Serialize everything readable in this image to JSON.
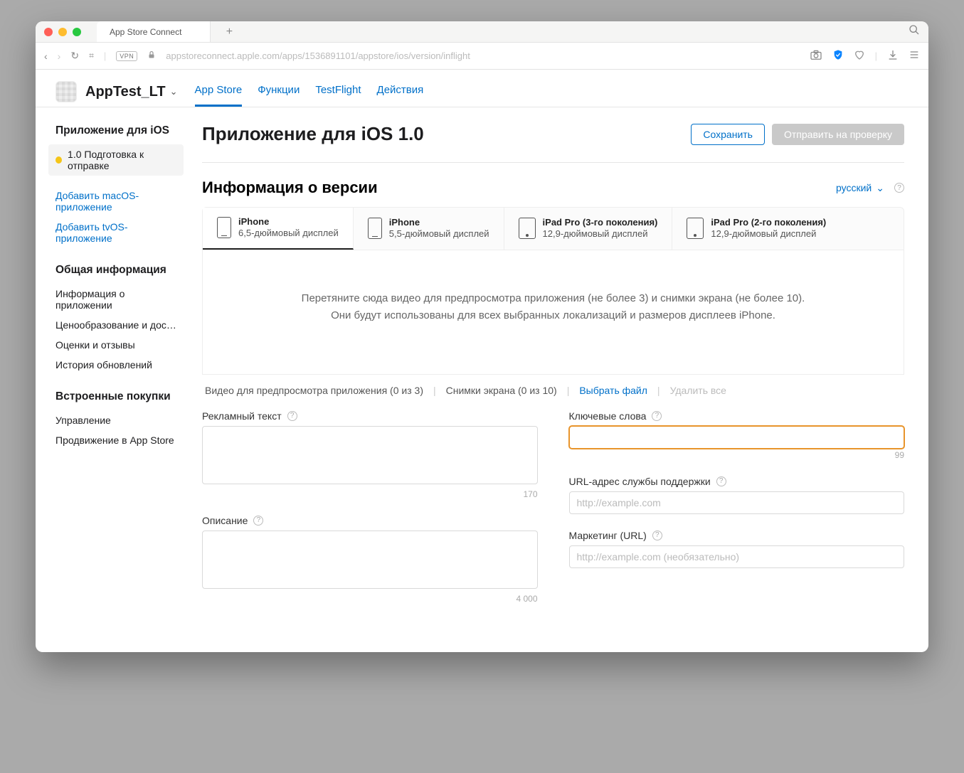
{
  "browser": {
    "tab_title": "App Store Connect",
    "url": "appstoreconnect.apple.com/apps/1536891101/appstore/ios/version/inflight",
    "vpn": "VPN"
  },
  "header": {
    "app_name": "AppTest_LT",
    "tabs": [
      "App Store",
      "Функции",
      "TestFlight",
      "Действия"
    ]
  },
  "sidebar": {
    "ios_title": "Приложение для iOS",
    "status": "1.0 Подготовка к отправке",
    "add_macos": "Добавить macOS-приложение",
    "add_tvos": "Добавить tvOS-приложение",
    "general_title": "Общая информация",
    "general_items": [
      "Информация о приложении",
      "Ценообразование и доступно…",
      "Оценки и отзывы",
      "История обновлений"
    ],
    "iap_title": "Встроенные покупки",
    "iap_items": [
      "Управление",
      "Продвижение в App Store"
    ]
  },
  "page": {
    "title": "Приложение для iOS 1.0",
    "save": "Сохранить",
    "submit": "Отправить на проверку"
  },
  "version": {
    "section_title": "Информация о версии",
    "language": "русский"
  },
  "devices": [
    {
      "l1": "iPhone",
      "l2": "6,5-дюймовый дисплей"
    },
    {
      "l1": "iPhone",
      "l2": "5,5-дюймовый дисплей"
    },
    {
      "l1": "iPad Pro (3-го поколения)",
      "l2": "12,9-дюймовый дисплей"
    },
    {
      "l1": "iPad Pro (2-го поколения)",
      "l2": "12,9-дюймовый дисплей"
    }
  ],
  "dropzone": {
    "line1": "Перетяните сюда видео для предпросмотра приложения (не более 3) и снимки экрана (не более 10).",
    "line2": "Они будут использованы для всех выбранных локализаций и размеров дисплеев iPhone."
  },
  "media_footer": {
    "previews": "Видео для предпросмотра приложения (0 из 3)",
    "screenshots": "Снимки экрана (0 из 10)",
    "choose": "Выбрать файл",
    "delete_all": "Удалить все"
  },
  "form": {
    "promo_label": "Рекламный текст",
    "promo_counter": "170",
    "desc_label": "Описание",
    "desc_counter": "4 000",
    "keywords_label": "Ключевые слова",
    "keywords_counter": "99",
    "support_label": "URL-адрес службы поддержки",
    "support_placeholder": "http://example.com",
    "marketing_label": "Маркетинг (URL)",
    "marketing_placeholder": "http://example.com (необязательно)"
  }
}
